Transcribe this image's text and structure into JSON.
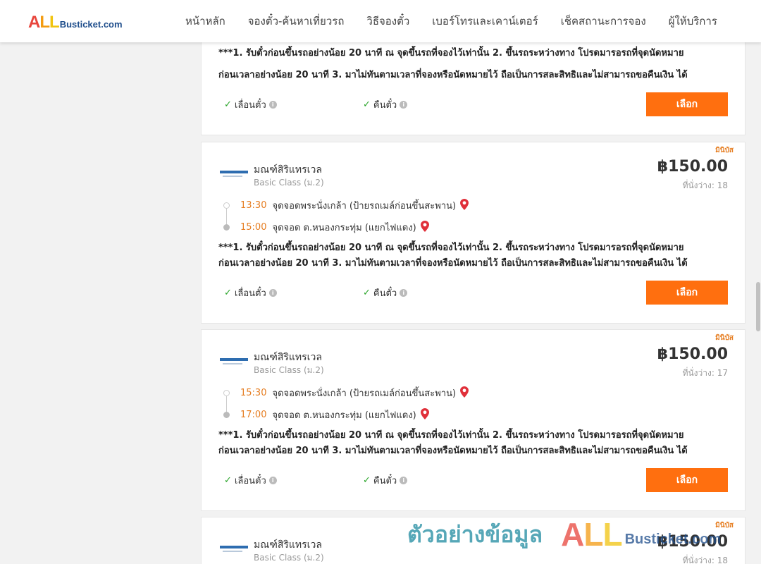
{
  "site": {
    "logo_all": "ALL",
    "logo_rest": "Busticket.com"
  },
  "nav": [
    {
      "label": "หน้าหลัก"
    },
    {
      "label": "จองตั๋ว-ค้นหาเที่ยวรถ"
    },
    {
      "label": "วิธีจองตั๋ว"
    },
    {
      "label": "เบอร์โทรและเคาน์เตอร์"
    },
    {
      "label": "เช็คสถานะการจอง"
    },
    {
      "label": "ผู้ให้บริการ"
    }
  ],
  "card0": {
    "remark_line1": "***1. รับตั๋วก่อนขึ้นรถอย่างน้อย 20 นาที ณ จุดขึ้นรถที่จองไว้เท่านั้น 2. ขึ้นรถระหว่างทาง โปรดมารอรถที่จุดนัดหมาย",
    "remark_line2": "ก่อนเวลาอย่างน้อย 20 นาที 3. มาไม่ทันตามเวลาที่จองหรือนัดหมายไว้ ถือเป็นการสละสิทธิและไม่สามารถขอคืนเงิน ได้",
    "feature_change": "เลื่อนตั๋ว",
    "feature_refund": "คืนตั๋ว",
    "select_label": "เลือก"
  },
  "card1": {
    "tag": "มินิบัส",
    "operator": "มณฑ์สิริแทรเวล",
    "class": "Basic Class (ม.2)",
    "price": "฿150.00",
    "seats": "ที่นั่งว่าง: 18",
    "depart_time": "13:30",
    "depart_place": "จุดจอดพระนั่งเกล้า (ป้ายรถเมล์ก่อนขึ้นสะพาน)",
    "arrive_time": "15:00",
    "arrive_place": "จุดจอด ต.หนองกระทุ่ม (แยกไฟแดง)",
    "remark_line1": "***1. รับตั๋วก่อนขึ้นรถอย่างน้อย 20 นาที ณ จุดขึ้นรถที่จองไว้เท่านั้น 2. ขึ้นรถระหว่างทาง โปรดมารอรถที่จุดนัดหมาย",
    "remark_line2": "ก่อนเวลาอย่างน้อย 20 นาที 3. มาไม่ทันตามเวลาที่จองหรือนัดหมายไว้ ถือเป็นการสละสิทธิและไม่สามารถขอคืนเงิน ได้",
    "feature_change": "เลื่อนตั๋ว",
    "feature_refund": "คืนตั๋ว",
    "select_label": "เลือก"
  },
  "card2": {
    "tag": "มินิบัส",
    "operator": "มณฑ์สิริแทรเวล",
    "class": "Basic Class (ม.2)",
    "price": "฿150.00",
    "seats": "ที่นั่งว่าง: 17",
    "depart_time": "15:30",
    "depart_place": "จุดจอดพระนั่งเกล้า (ป้ายรถเมล์ก่อนขึ้นสะพาน)",
    "arrive_time": "17:00",
    "arrive_place": "จุดจอด ต.หนองกระทุ่ม (แยกไฟแดง)",
    "remark_line1": "***1. รับตั๋วก่อนขึ้นรถอย่างน้อย 20 นาที ณ จุดขึ้นรถที่จองไว้เท่านั้น 2. ขึ้นรถระหว่างทาง โปรดมารอรถที่จุดนัดหมาย",
    "remark_line2": "ก่อนเวลาอย่างน้อย 20 นาที 3. มาไม่ทันตามเวลาที่จองหรือนัดหมายไว้ ถือเป็นการสละสิทธิและไม่สามารถขอคืนเงิน ได้",
    "feature_change": "เลื่อนตั๋ว",
    "feature_refund": "คืนตั๋ว",
    "select_label": "เลือก"
  },
  "card3": {
    "tag": "มินิบัส",
    "operator": "มณฑ์สิริแทรเวล",
    "class": "Basic Class (ม.2)",
    "price": "฿150.00",
    "seats": "ที่นั่งว่าง: 18"
  },
  "watermark": {
    "text": "ตัวอย่างข้อมูล",
    "logo_all": "ALL",
    "logo_rest": "Busticket.com"
  },
  "colors": {
    "accent": "#ff6f0f",
    "time": "#e67e22",
    "check": "#2aa52a",
    "pin": "#e0303a"
  },
  "icons": [
    "check-icon",
    "info-icon",
    "map-pin-icon"
  ]
}
